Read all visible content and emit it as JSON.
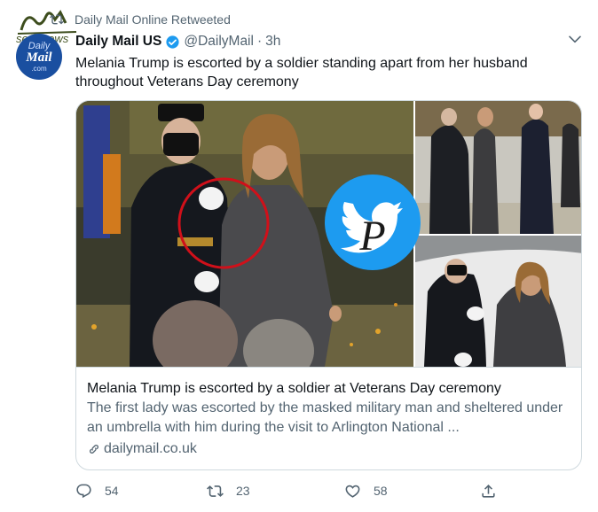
{
  "retweet": {
    "label": "Daily Mail Online Retweeted"
  },
  "watermark": {
    "text": "seratnews"
  },
  "avatar": {
    "line1": "Daily",
    "line2": "Mail",
    "line3": ".com"
  },
  "tweet": {
    "display_name": "Daily Mail US",
    "handle": "@DailyMail",
    "dot": "·",
    "time": "3h",
    "text": "Melania Trump is escorted by a soldier standing apart from her husband throughout Veterans Day ceremony"
  },
  "card": {
    "title": "Melania Trump is escorted by a soldier at Veterans Day ceremony",
    "description": "The first lady was escorted by the masked military man and sheltered under an umbrella with him during the visit to Arlington National ...",
    "domain": "dailymail.co.uk",
    "overlay_logo": "P"
  },
  "actions": {
    "replies": "54",
    "retweets": "23",
    "likes": "58"
  },
  "colors": {
    "accent": "#1d9bf0",
    "text_primary": "#0f1419",
    "text_secondary": "#536471",
    "border": "#cfd9de",
    "highlight_circle": "#d0101a"
  },
  "icons": [
    "retweet-icon",
    "verified-badge-icon",
    "chevron-down-icon",
    "link-icon",
    "reply-icon",
    "retweet-action-icon",
    "like-icon",
    "share-icon",
    "twitter-bird-icon"
  ]
}
